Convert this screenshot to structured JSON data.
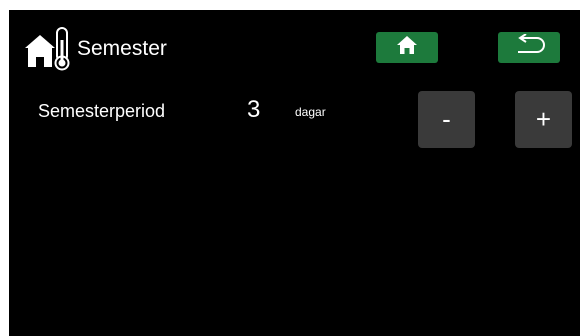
{
  "header": {
    "title": "Semester",
    "icon": "house-thermometer-icon"
  },
  "nav": {
    "home_icon": "home-icon",
    "back_icon": "back-arrow-icon",
    "button_color": "#1d7a3c"
  },
  "setting": {
    "label": "Semesterperiod",
    "value": "3",
    "unit": "dagar"
  },
  "stepper": {
    "minus_label": "-",
    "plus_label": "+",
    "button_color": "#3a3a3a"
  },
  "theme": {
    "background": "#000000",
    "text": "#ffffff"
  }
}
